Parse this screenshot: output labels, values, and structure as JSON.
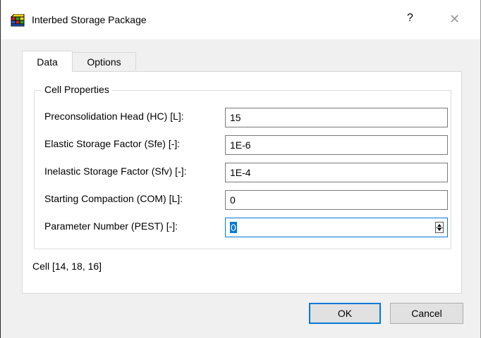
{
  "window": {
    "title": "Interbed Storage Package",
    "help_label": "?",
    "close_label": "✕"
  },
  "tabs": [
    {
      "label": "Data",
      "selected": true
    },
    {
      "label": "Options",
      "selected": false
    }
  ],
  "cell_properties": {
    "group_title": "Cell Properties",
    "rows": [
      {
        "label": "Preconsolidation Head (HC) [L]:",
        "value": "15"
      },
      {
        "label": "Elastic Storage Factor (Sfe) [-]:",
        "value": "1E-6"
      },
      {
        "label": "Inelastic Storage Factor (Sfv) [-]:",
        "value": "1E-4"
      },
      {
        "label": "Starting Compaction (COM) [L]:",
        "value": "0"
      },
      {
        "label": "Parameter Number (PEST) [-]:",
        "value": "0"
      }
    ]
  },
  "cell_info": "Cell [14, 18, 16]",
  "buttons": {
    "ok": "OK",
    "cancel": "Cancel"
  },
  "colors": {
    "accent": "#0078d7",
    "window_bg": "#f0f0f0"
  }
}
